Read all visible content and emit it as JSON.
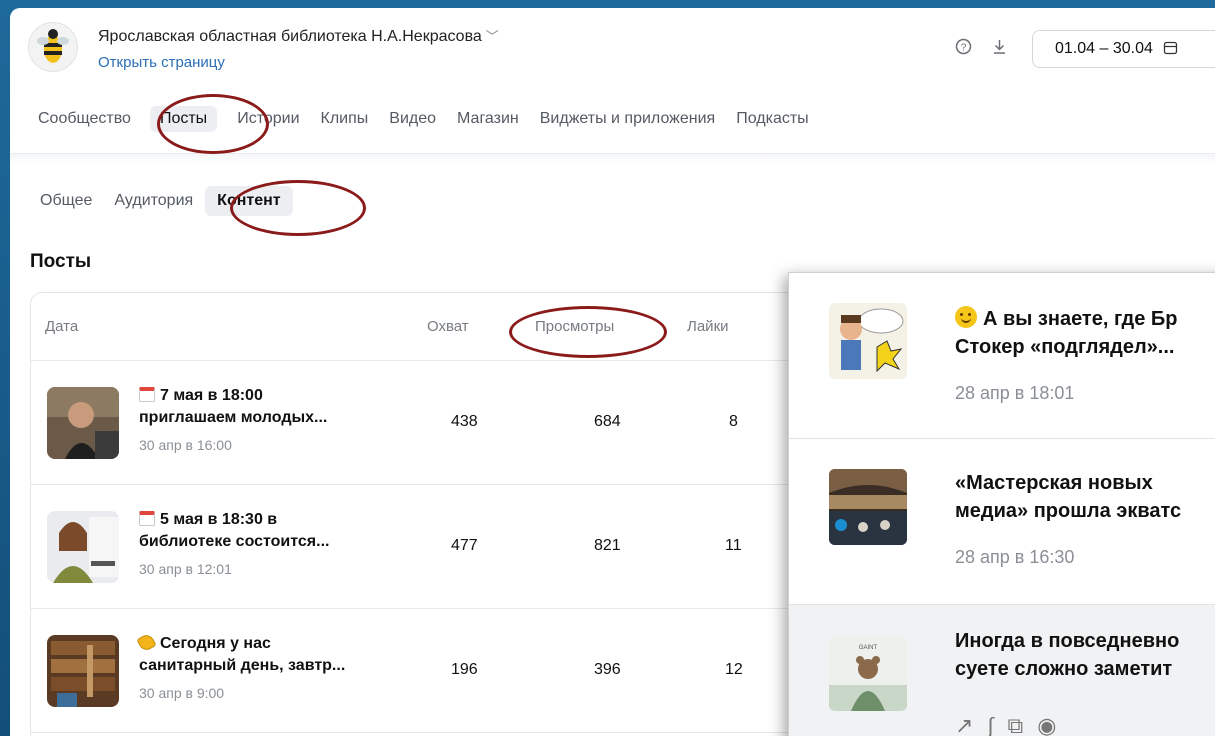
{
  "header": {
    "org_name": "Ярославская областная библиотека Н.А.Некрасова",
    "open_page": "Открыть страницу",
    "date_range": "01.04 – 30.04",
    "help_icon": "help-circle-icon",
    "download_icon": "download-icon",
    "calendar_icon": "calendar-icon"
  },
  "tabs": [
    {
      "label": "Сообщество"
    },
    {
      "label": "Посты",
      "active": true
    },
    {
      "label": "Истории"
    },
    {
      "label": "Клипы"
    },
    {
      "label": "Видео"
    },
    {
      "label": "Магазин"
    },
    {
      "label": "Виджеты и приложения"
    },
    {
      "label": "Подкасты"
    }
  ],
  "subtabs": [
    {
      "label": "Общее"
    },
    {
      "label": "Аудитория"
    },
    {
      "label": "Контент",
      "active": true
    }
  ],
  "section_title": "Посты",
  "table": {
    "columns": {
      "date": "Дата",
      "reach": "Охват",
      "views": "Просмотры",
      "likes": "Лайки"
    },
    "rows": [
      {
        "title1": "7 мая в 18:00",
        "title2": "приглашаем молодых...",
        "date": "30 апр в 16:00",
        "reach": "438",
        "views": "684",
        "likes": "8",
        "emoji": "calendar-icon"
      },
      {
        "title1": "5 мая в 18:30 в",
        "title2": "библиотеке состоится...",
        "date": "30 апр в 12:01",
        "reach": "477",
        "views": "821",
        "likes": "11",
        "emoji": "calendar-icon"
      },
      {
        "title1": "Сегодня у нас",
        "title2": "санитарный день, завтр...",
        "date": "30 апр в 9:00",
        "reach": "196",
        "views": "396",
        "likes": "12",
        "emoji": "diamond-icon"
      }
    ]
  },
  "overlay": {
    "rows": [
      {
        "line1": "А вы знаете, где Бр",
        "line2": "Стокер «подглядел»...",
        "date": "28 апр в 18:01",
        "emoji": "smile-icon"
      },
      {
        "line1": "«Мастерская новых",
        "line2": "медиа» прошла экватс",
        "date": "28 апр в 16:30"
      },
      {
        "line1": "Иногда в повседневно",
        "line2": "суете сложно заметит",
        "icons": [
          "trend-icon",
          "link-icon",
          "share-icon",
          "eye-icon"
        ]
      }
    ]
  },
  "colors": {
    "accent": "#2a6fb5",
    "annotation": "#8b1a1a",
    "background": "#1a5f8e"
  }
}
